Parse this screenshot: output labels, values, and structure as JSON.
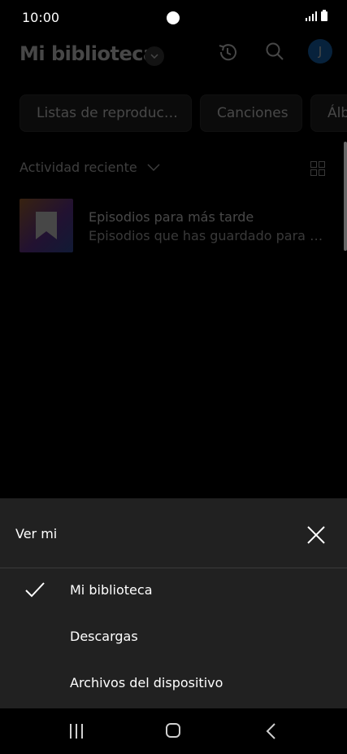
{
  "status": {
    "time": "10:00"
  },
  "header": {
    "title": "Mi biblioteca",
    "avatar_letter": "J"
  },
  "chips": [
    "Listas de reproduc…",
    "Canciones",
    "Álb"
  ],
  "activity": {
    "label": "Actividad reciente"
  },
  "item": {
    "title": "Episodios para más tarde",
    "subtitle": "Episodios que has guardado para más…"
  },
  "sheet": {
    "title": "Ver mi",
    "options": [
      {
        "label": "Mi biblioteca",
        "selected": true
      },
      {
        "label": "Descargas",
        "selected": false
      },
      {
        "label": "Archivos del dispositivo",
        "selected": false
      }
    ]
  },
  "colors": {
    "avatar": "#1a7bd6",
    "sheet_bg": "#212121"
  }
}
